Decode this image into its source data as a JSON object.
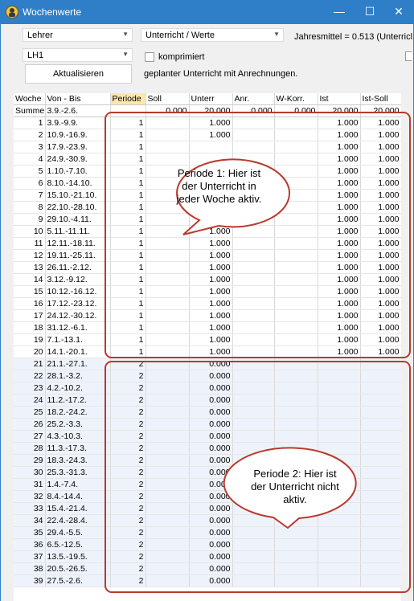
{
  "window": {
    "title": "Wochenwerte",
    "minimize": "—",
    "maximize": "☐",
    "close": "✕"
  },
  "controls": {
    "combo1": "Lehrer",
    "combo2": "Unterricht / Werte",
    "combo3": "LH1",
    "jahresmittel": "Jahresmittel = 0.513 (Unterricl",
    "checkbox_label": "komprimiert",
    "refresh_button": "Aktualisieren",
    "info": "geplanter Unterricht mit Anrechnungen."
  },
  "table": {
    "headers": [
      "Woche",
      "Von - Bis",
      "Periode",
      "Soll",
      "Unterr",
      "Anr.",
      "W-Korr.",
      "Ist",
      "Ist-Soll"
    ],
    "summe": [
      "Summe",
      "3.9.-2.6.",
      "",
      "0.000",
      "20.000",
      "0.000",
      "0.000",
      "20.000",
      "20.000"
    ],
    "rows": [
      [
        "1",
        "3.9.-9.9.",
        "1",
        "",
        "1.000",
        "",
        "",
        "1.000",
        "1.000"
      ],
      [
        "2",
        "10.9.-16.9.",
        "1",
        "",
        "1.000",
        "",
        "",
        "1.000",
        "1.000"
      ],
      [
        "3",
        "17.9.-23.9.",
        "1",
        "",
        "",
        "",
        "",
        "1.000",
        "1.000"
      ],
      [
        "4",
        "24.9.-30.9.",
        "1",
        "",
        "",
        "",
        "",
        "1.000",
        "1.000"
      ],
      [
        "5",
        "1.10.-7.10.",
        "1",
        "",
        "",
        "",
        "",
        "1.000",
        "1.000"
      ],
      [
        "6",
        "8.10.-14.10.",
        "1",
        "",
        "",
        "",
        "",
        "1.000",
        "1.000"
      ],
      [
        "7",
        "15.10.-21.10.",
        "1",
        "",
        "",
        "",
        "",
        "1.000",
        "1.000"
      ],
      [
        "8",
        "22.10.-28.10.",
        "1",
        "",
        "",
        "",
        "",
        "1.000",
        "1.000"
      ],
      [
        "9",
        "29.10.-4.11.",
        "1",
        "",
        "",
        "",
        "",
        "1.000",
        "1.000"
      ],
      [
        "10",
        "5.11.-11.11.",
        "1",
        "",
        "1.000",
        "",
        "",
        "1.000",
        "1.000"
      ],
      [
        "11",
        "12.11.-18.11.",
        "1",
        "",
        "1.000",
        "",
        "",
        "1.000",
        "1.000"
      ],
      [
        "12",
        "19.11.-25.11.",
        "1",
        "",
        "1.000",
        "",
        "",
        "1.000",
        "1.000"
      ],
      [
        "13",
        "26.11.-2.12.",
        "1",
        "",
        "1.000",
        "",
        "",
        "1.000",
        "1.000"
      ],
      [
        "14",
        "3.12.-9.12.",
        "1",
        "",
        "1.000",
        "",
        "",
        "1.000",
        "1.000"
      ],
      [
        "15",
        "10.12.-16.12.",
        "1",
        "",
        "1.000",
        "",
        "",
        "1.000",
        "1.000"
      ],
      [
        "16",
        "17.12.-23.12.",
        "1",
        "",
        "1.000",
        "",
        "",
        "1.000",
        "1.000"
      ],
      [
        "17",
        "24.12.-30.12.",
        "1",
        "",
        "1.000",
        "",
        "",
        "1.000",
        "1.000"
      ],
      [
        "18",
        "31.12.-6.1.",
        "1",
        "",
        "1.000",
        "",
        "",
        "1.000",
        "1.000"
      ],
      [
        "19",
        "7.1.-13.1.",
        "1",
        "",
        "1.000",
        "",
        "",
        "1.000",
        "1.000"
      ],
      [
        "20",
        "14.1.-20.1.",
        "1",
        "",
        "1.000",
        "",
        "",
        "1.000",
        "1.000"
      ],
      [
        "21",
        "21.1.-27.1.",
        "2",
        "",
        "0.000",
        "",
        "",
        "",
        ""
      ],
      [
        "22",
        "28.1.-3.2.",
        "2",
        "",
        "0.000",
        "",
        "",
        "",
        ""
      ],
      [
        "23",
        "4.2.-10.2.",
        "2",
        "",
        "0.000",
        "",
        "",
        "",
        ""
      ],
      [
        "24",
        "11.2.-17.2.",
        "2",
        "",
        "0.000",
        "",
        "",
        "",
        ""
      ],
      [
        "25",
        "18.2.-24.2.",
        "2",
        "",
        "0.000",
        "",
        "",
        "",
        ""
      ],
      [
        "26",
        "25.2.-3.3.",
        "2",
        "",
        "0.000",
        "",
        "",
        "",
        ""
      ],
      [
        "27",
        "4.3.-10.3.",
        "2",
        "",
        "0.000",
        "",
        "",
        "",
        ""
      ],
      [
        "28",
        "11.3.-17.3.",
        "2",
        "",
        "0.000",
        "",
        "",
        "",
        ""
      ],
      [
        "29",
        "18.3.-24.3.",
        "2",
        "",
        "0.000",
        "",
        "",
        "",
        ""
      ],
      [
        "30",
        "25.3.-31.3.",
        "2",
        "",
        "0.000",
        "",
        "",
        "",
        ""
      ],
      [
        "31",
        "1.4.-7.4.",
        "2",
        "",
        "0.000",
        "",
        "",
        "",
        ""
      ],
      [
        "32",
        "8.4.-14.4.",
        "2",
        "",
        "0.000",
        "",
        "",
        "",
        ""
      ],
      [
        "33",
        "15.4.-21.4.",
        "2",
        "",
        "0.000",
        "",
        "",
        "",
        ""
      ],
      [
        "34",
        "22.4.-28.4.",
        "2",
        "",
        "0.000",
        "",
        "",
        "",
        ""
      ],
      [
        "35",
        "29.4.-5.5.",
        "2",
        "",
        "0.000",
        "",
        "",
        "",
        ""
      ],
      [
        "36",
        "6.5.-12.5.",
        "2",
        "",
        "0.000",
        "",
        "",
        "",
        ""
      ],
      [
        "37",
        "13.5.-19.5.",
        "2",
        "",
        "0.000",
        "",
        "",
        "",
        ""
      ],
      [
        "38",
        "20.5.-26.5.",
        "2",
        "",
        "0.000",
        "",
        "",
        "",
        ""
      ],
      [
        "39",
        "27.5.-2.6.",
        "2",
        "",
        "0.000",
        "",
        "",
        "",
        ""
      ]
    ]
  },
  "callouts": {
    "period1": [
      "Periode 1: Hier ist",
      "der Unterricht in",
      "jeder Woche aktiv."
    ],
    "period2": [
      "Periode 2: Hier ist",
      "der Unterricht nicht",
      "aktiv."
    ]
  },
  "colors": {
    "titlebar": "#2f7fc8",
    "annotation": "#b83a2c",
    "period_header": "#fbe6b0",
    "period2_row": "#eef3fb"
  }
}
